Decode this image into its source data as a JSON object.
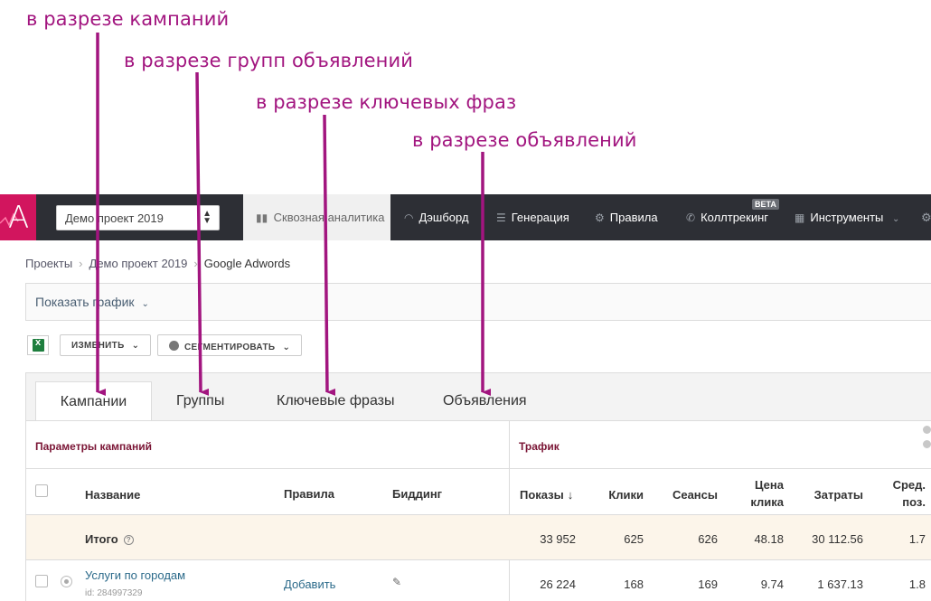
{
  "annotations": [
    "в разрезе кампаний",
    "в разрезе групп объявлений",
    "в разрезе ключевых фраз",
    "в разрезе объявлений"
  ],
  "logo": "A",
  "project_select": {
    "value": "Демо проект 2019"
  },
  "nav": [
    {
      "label": "Сквозная аналитика",
      "icon": "bar-chart-icon",
      "active": true
    },
    {
      "label": "Дэшборд",
      "icon": "gauge-icon"
    },
    {
      "label": "Генерация",
      "icon": "list-icon"
    },
    {
      "label": "Правила",
      "icon": "gears-icon"
    },
    {
      "label": "Коллтрекинг",
      "icon": "phone-icon",
      "badge": "BETA"
    },
    {
      "label": "Инструменты",
      "icon": "grid-icon"
    }
  ],
  "breadcrumb": [
    "Проекты",
    "Демо проект 2019",
    "Google Adwords"
  ],
  "show_chart": "Показать график",
  "toolbar": {
    "edit": "ИЗМЕНИТЬ",
    "segment": "СЕГМЕНТИРОВАТЬ"
  },
  "tabs": [
    "Кампании",
    "Группы",
    "Ключевые фразы",
    "Объявления"
  ],
  "table": {
    "section_params": "Параметры кампаний",
    "section_traffic": "Трафик",
    "headers": {
      "name": "Название",
      "rules": "Правила",
      "bidding": "Биддинг",
      "impressions": "Показы",
      "clicks": "Клики",
      "sessions": "Сеансы",
      "cpc_line1": "Цена",
      "cpc_line2": "клика",
      "cost": "Затраты",
      "avg_line1": "Сред.",
      "avg_line2": "поз."
    },
    "total": {
      "label": "Итого",
      "impressions": "33 952",
      "clicks": "625",
      "sessions": "626",
      "cpc": "48.18",
      "cost": "30 112.56",
      "avg_pos": "1.7"
    },
    "rows": [
      {
        "name": "Услуги по городам",
        "id": "id: 284997329",
        "rules": "Добавить",
        "impressions": "26 224",
        "clicks": "168",
        "sessions": "169",
        "cpc": "9.74",
        "cost": "1 637.13",
        "avg_pos": "1.8"
      }
    ]
  }
}
